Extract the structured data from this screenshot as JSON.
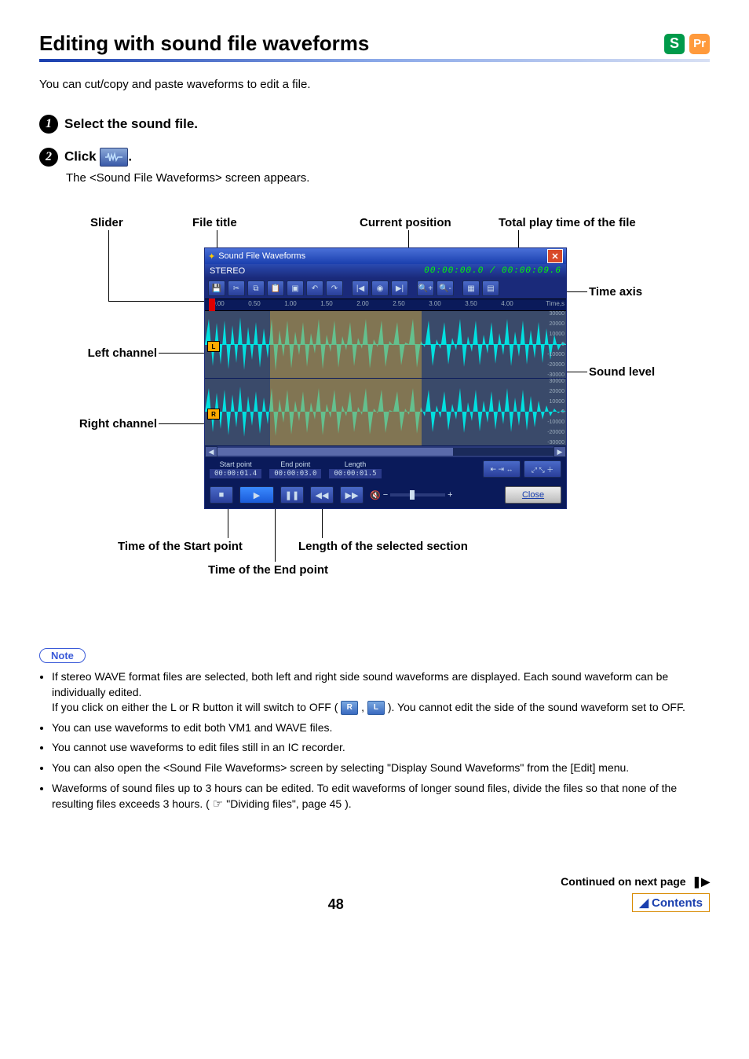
{
  "header": {
    "title": "Editing with sound file waveforms",
    "badge_s": "S",
    "badge_pr": "Pr"
  },
  "intro": "You can cut/copy and paste waveforms to edit a file.",
  "steps": {
    "s1": {
      "num": "1",
      "text": "Select the sound file."
    },
    "s2": {
      "num": "2",
      "prefix": "Click ",
      "suffix": ".",
      "sub": "The <Sound File Waveforms> screen appears."
    }
  },
  "diagram_labels": {
    "slider": "Slider",
    "file_title": "File title",
    "current_pos": "Current position",
    "total_time": "Total play time of the file",
    "time_axis": "Time axis",
    "left_channel": "Left channel",
    "sound_level": "Sound level",
    "right_channel": "Right channel",
    "start_time": "Time of the Start point",
    "end_time": "Time of the End point",
    "sel_length": "Length of the selected section"
  },
  "window": {
    "title": "Sound File Waveforms",
    "stereo": "STEREO",
    "time": "00:00:00.0 / 00:00:09.6",
    "ruler": [
      "0.00",
      "0.50",
      "1.00",
      "1.50",
      "2.00",
      "2.50",
      "3.00",
      "3.50",
      "4.00",
      "Time,s"
    ],
    "ch_l": "L",
    "ch_r": "R",
    "amps": [
      "30000",
      "20000",
      "10000",
      "0",
      "-10000",
      "-20000",
      "-30000"
    ],
    "start": {
      "label": "Start point",
      "val": "00:00:01.4"
    },
    "end": {
      "label": "End point",
      "val": "00:00:03.0"
    },
    "len": {
      "label": "Length",
      "val": "00:00:01.5"
    },
    "close": "Close"
  },
  "note_label": "Note",
  "notes": {
    "n1a": "If stereo WAVE format files are selected, both left and right side sound waveforms are displayed. Each sound waveform can be individually edited.",
    "n1b_pre": "If you click on either the L or R button it will switch to OFF (",
    "n1b_mid": ", ",
    "n1b_post": "). You cannot edit the side of the sound waveform set to OFF.",
    "chip_r": "R",
    "chip_l": "L",
    "n2": "You can use waveforms to edit both VM1 and WAVE files.",
    "n3": "You cannot use waveforms to edit files still in an IC recorder.",
    "n4": "You can also open the <Sound File Waveforms> screen by selecting \"Display Sound Waveforms\" from the [Edit] menu.",
    "n5_pre": "Waveforms of sound files up to 3 hours can be edited. To edit waveforms of longer sound files, divide the files so that none of the resulting files exceeds 3 hours. (",
    "n5_link": "\"Dividing files\", page 45",
    "n5_post": ")."
  },
  "footer": {
    "continued": "Continued on next page",
    "page": "48",
    "contents": "Contents"
  }
}
